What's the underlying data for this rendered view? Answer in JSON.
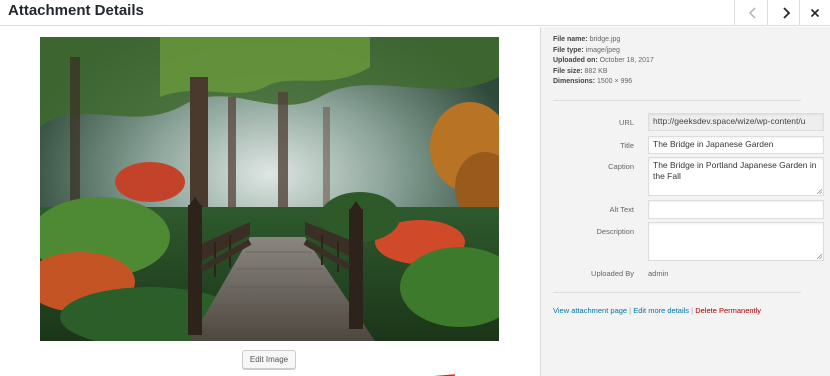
{
  "header": {
    "title": "Attachment Details",
    "prev_icon": "chevron-left-icon",
    "next_icon": "chevron-right-icon",
    "close_icon": "close-icon"
  },
  "media": {
    "image_alt": "The Bridge in Japanese Garden",
    "edit_button_label": "Edit Image"
  },
  "details": {
    "file_name_label": "File name:",
    "file_name": "bridge.jpg",
    "file_type_label": "File type:",
    "file_type": "image/jpeg",
    "uploaded_on_label": "Uploaded on:",
    "uploaded_on": "October 18, 2017",
    "file_size_label": "File size:",
    "file_size": "882 KB",
    "dimensions_label": "Dimensions:",
    "dimensions": "1500 × 996"
  },
  "form": {
    "url_label": "URL",
    "url_value": "http://geeksdev.space/wize/wp-content/u",
    "title_label": "Title",
    "title_value": "The Bridge in Japanese Garden",
    "caption_label": "Caption",
    "caption_value": "The Bridge in Portland Japanese Garden in the Fall",
    "alt_label": "Alt Text",
    "alt_value": "",
    "description_label": "Description",
    "description_value": "",
    "uploaded_by_label": "Uploaded By",
    "uploaded_by_value": "admin"
  },
  "actions": {
    "view_link": "View attachment page",
    "sep1": " | ",
    "edit_link": "Edit more details",
    "sep2": " | ",
    "delete_link": "Delete Permanently"
  },
  "colors": {
    "link": "#0073aa",
    "delete": "#aa0000",
    "annotation_arrow": "#e02020"
  }
}
